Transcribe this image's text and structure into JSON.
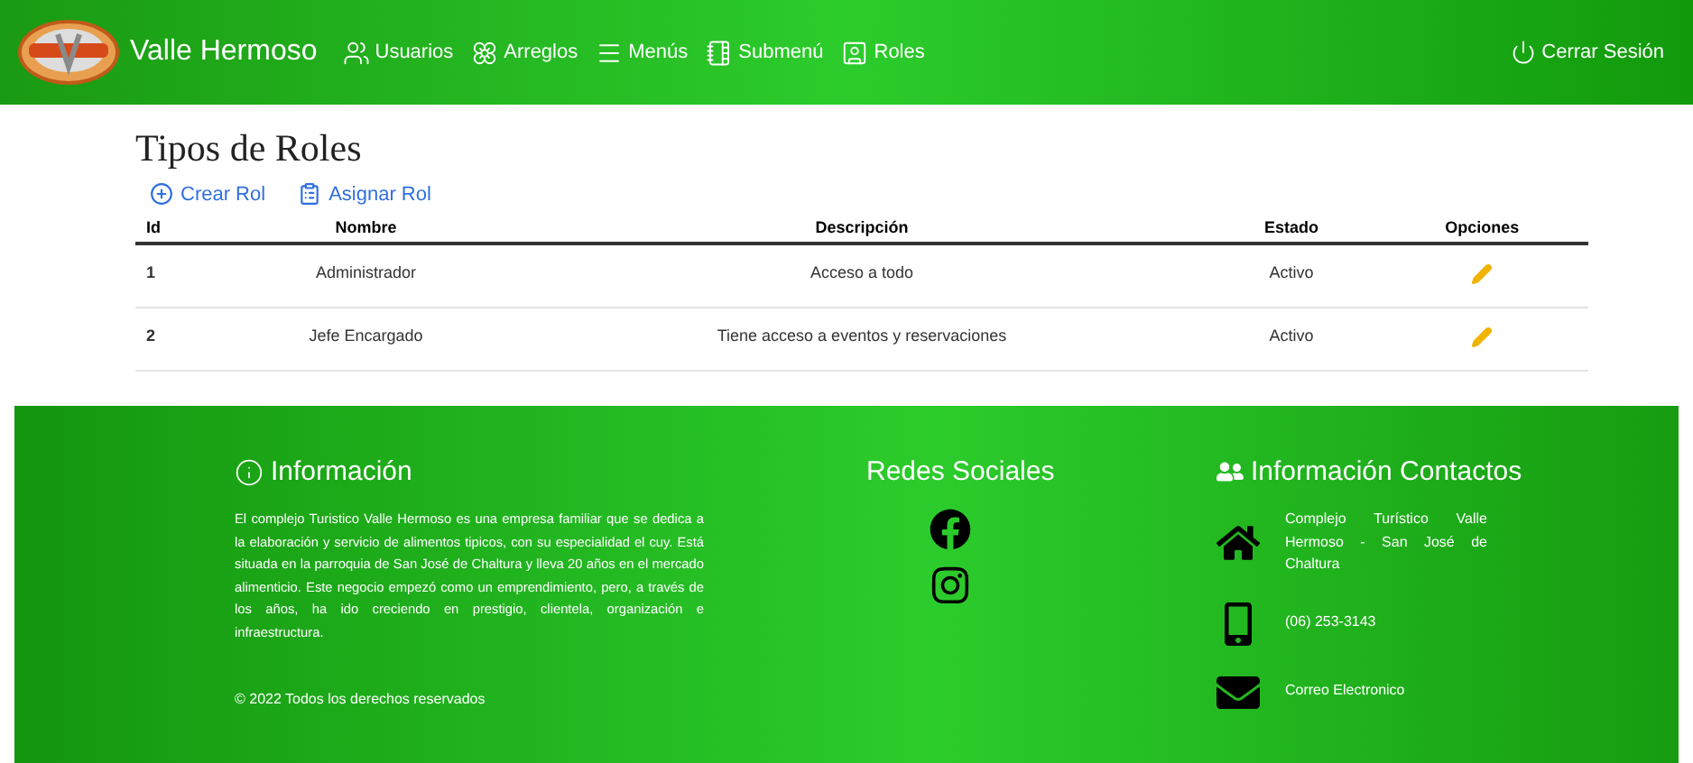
{
  "navbar": {
    "brand": "Valle Hermoso",
    "items": [
      {
        "kind": "users",
        "label": "Usuarios"
      },
      {
        "kind": "flower",
        "label": "Arreglos"
      },
      {
        "kind": "menu",
        "label": "Menús"
      },
      {
        "kind": "list",
        "label": "Submenú"
      },
      {
        "kind": "user-card",
        "label": "Roles"
      }
    ],
    "logout": "Cerrar Sesión"
  },
  "page": {
    "title": "Tipos de Roles",
    "actions": [
      {
        "kind": "add",
        "label": "Crear Rol"
      },
      {
        "kind": "clipboard",
        "label": "Asignar Rol"
      }
    ],
    "table": {
      "columns": [
        "Id",
        "Nombre",
        "Descripción",
        "Estado",
        "Opciones"
      ],
      "rows": [
        {
          "id": "1",
          "name": "Administrador",
          "description": "Acceso a todo",
          "status": "Activo"
        },
        {
          "id": "2",
          "name": "Jefe Encargado",
          "description": "Tiene acceso a eventos y reservaciones",
          "status": "Activo"
        }
      ]
    }
  },
  "footer": {
    "info": {
      "title": "Información",
      "text": "El complejo Turistico Valle Hermoso es una empresa familiar que se dedica a la elaboración y servicio de alimentos tipicos, con su especialidad el cuy. Está situada en la parroquia de San José de Chaltura y lleva 20 años en el mercado alimenticio. Este negocio empezó como un emprendimiento, pero, a través de los años, ha ido creciendo en prestigio, clientela, organización e infraestructura.",
      "copyright": "© 2022 Todos los derechos reservados"
    },
    "social": {
      "title": "Redes Sociales",
      "links": [
        {
          "kind": "facebook"
        },
        {
          "kind": "instagram"
        }
      ]
    },
    "contacts": {
      "title": "Información Contactos",
      "items": [
        {
          "kind": "address",
          "text": "Complejo Turístico Valle Hermoso - San José de Chaltura"
        },
        {
          "kind": "phone",
          "text": "(06) 253-3143"
        },
        {
          "kind": "email",
          "text": "Correo Electronico"
        }
      ]
    }
  }
}
